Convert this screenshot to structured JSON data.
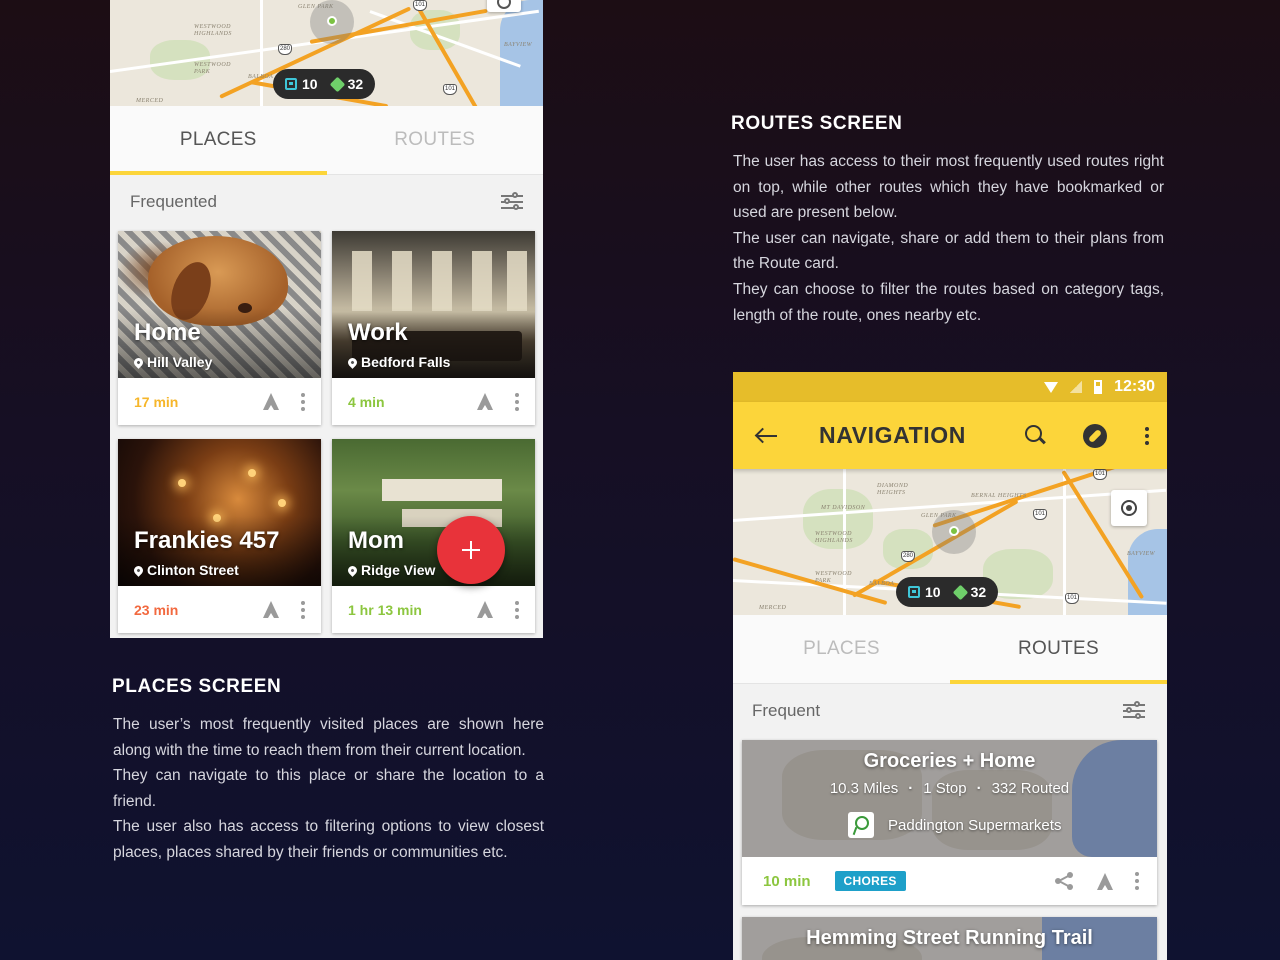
{
  "places_screen": {
    "map": {
      "pill_calendar_count": "10",
      "pill_diamond_count": "32",
      "labels": [
        "GLEN PARK",
        "WESTWOOD HIGHLANDS",
        "WESTWOOD PARK",
        "BALBOA",
        "MERCED",
        "BAYVIEW"
      ],
      "shields": [
        "101",
        "280",
        "101"
      ]
    },
    "tabs": [
      {
        "label": "PLACES",
        "active": true
      },
      {
        "label": "ROUTES",
        "active": false
      }
    ],
    "section_title": "Frequented",
    "cards": [
      {
        "title": "Home",
        "location": "Hill Valley",
        "time": "17 min",
        "time_color": "#f6b62a"
      },
      {
        "title": "Work",
        "location": "Bedford Falls",
        "time": "4 min",
        "time_color": "#8cc63f"
      },
      {
        "title": "Frankies 457",
        "location": "Clinton Street",
        "time": "23 min",
        "time_color": "#f2693f"
      },
      {
        "title": "Mom",
        "location": "Ridge View",
        "time": "1 hr 13 min",
        "time_color": "#8cc63f"
      }
    ],
    "fab_icon": "plus-icon"
  },
  "places_text": {
    "heading": "PLACES SCREEN",
    "paragraphs": [
      "The user’s most frequently visited places are shown here along with the time to reach them from their current location.",
      "They can navigate to this place or share the location to a friend.",
      "The user also has access to filtering options to view closest places, places shared by their friends or communities etc."
    ]
  },
  "routes_text": {
    "heading": "ROUTES SCREEN",
    "paragraphs": [
      "The user has access to their most frequently used routes right on top, while other routes which they have bookmarked or used are present below.",
      "The user can navigate, share or add them to their plans from the Route card.",
      "They can choose to filter the routes based on category tags, length of the route, ones nearby etc."
    ]
  },
  "routes_screen": {
    "status_time": "12:30",
    "appbar_title": "NAVIGATION",
    "map": {
      "pill_calendar_count": "10",
      "pill_diamond_count": "32",
      "labels": [
        "DIAMOND HEIGHTS",
        "BERNAL HEIGHTS",
        "MT DAVIDSON",
        "GLEN PARK",
        "WESTWOOD HIGHLANDS",
        "WESTWOOD PARK",
        "BALBOA",
        "BAYVIEW",
        "MERCED"
      ],
      "shields": [
        "101",
        "101",
        "280",
        "101"
      ]
    },
    "tabs": [
      {
        "label": "PLACES",
        "active": false
      },
      {
        "label": "ROUTES",
        "active": true
      }
    ],
    "section_title": "Frequent",
    "routes": [
      {
        "title": "Groceries + Home",
        "distance": "10.3 Miles",
        "stops": "1 Stop",
        "routed": "332 Routed",
        "poi": "Paddington Supermarkets",
        "time": "10 min",
        "tag": "CHORES"
      },
      {
        "title": "Hemming Street Running Trail"
      }
    ],
    "colors": {
      "accent": "#fcd53a",
      "tag": "#1ea0c9",
      "time_green": "#8cc63f"
    }
  }
}
